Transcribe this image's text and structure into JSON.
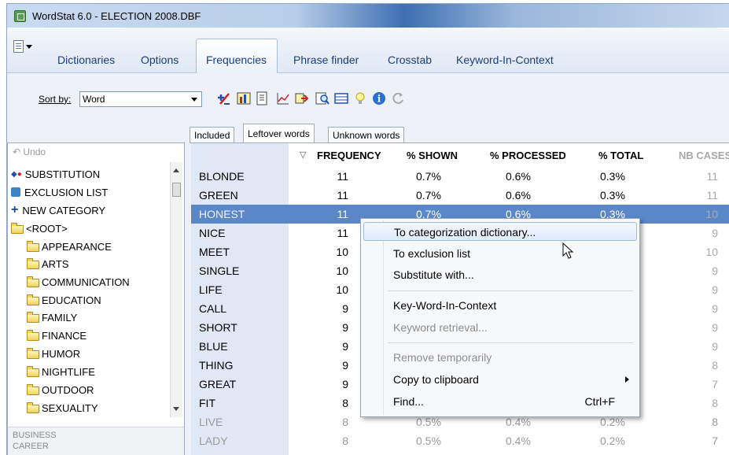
{
  "window": {
    "title": "WordStat 6.0 - ELECTION 2008.DBF"
  },
  "menu": {
    "items": [
      "Dictionaries",
      "Options",
      "Frequencies",
      "Phrase finder",
      "Crosstab",
      "Keyword-In-Context"
    ],
    "active": "Frequencies"
  },
  "toolbar": {
    "sort_label": "Sort by:",
    "sort_value": "Word",
    "icons": [
      "add-remove-icon",
      "chart-icon",
      "export-icon",
      "graph-icon",
      "arrow-icon",
      "search-icon",
      "table-icon",
      "bulb-icon",
      "info-icon",
      "refresh-icon"
    ]
  },
  "subtabs": [
    "Included",
    "Leftover words",
    "Unknown words"
  ],
  "left": {
    "undo": "Undo",
    "substitution": "SUBSTITUTION",
    "exclusion": "EXCLUSION LIST",
    "new_category": "NEW CATEGORY",
    "root": "<ROOT>",
    "categories": [
      "APPEARANCE",
      "ARTS",
      "COMMUNICATION",
      "EDUCATION",
      "FAMILY",
      "FINANCE",
      "HUMOR",
      "NIGHTLIFE",
      "OUTDOOR",
      "SEXUALITY"
    ],
    "bottom": [
      "BUSINESS",
      "CAREER"
    ]
  },
  "table": {
    "headers": [
      "FREQUENCY",
      "% SHOWN",
      "% PROCESSED",
      "% TOTAL",
      "NB CASES"
    ],
    "rows": [
      {
        "word": "BLONDE",
        "freq": "11",
        "shown": "0.7%",
        "proc": "0.6%",
        "total": "0.3%",
        "nb": "11"
      },
      {
        "word": "GREEN",
        "freq": "11",
        "shown": "0.7%",
        "proc": "0.6%",
        "total": "0.3%",
        "nb": "11"
      },
      {
        "word": "HONEST",
        "freq": "11",
        "shown": "0.7%",
        "proc": "0.6%",
        "total": "0.3%",
        "nb": "10"
      },
      {
        "word": "NICE",
        "freq": "11",
        "shown": "",
        "proc": "",
        "total": "",
        "nb": "9"
      },
      {
        "word": "MEET",
        "freq": "10",
        "shown": "",
        "proc": "",
        "total": "",
        "nb": "10"
      },
      {
        "word": "SINGLE",
        "freq": "10",
        "shown": "",
        "proc": "",
        "total": "",
        "nb": "9"
      },
      {
        "word": "LIFE",
        "freq": "10",
        "shown": "",
        "proc": "",
        "total": "",
        "nb": "9"
      },
      {
        "word": "CALL",
        "freq": "9",
        "shown": "",
        "proc": "",
        "total": "",
        "nb": "9"
      },
      {
        "word": "SHORT",
        "freq": "9",
        "shown": "",
        "proc": "",
        "total": "",
        "nb": "9"
      },
      {
        "word": "BLUE",
        "freq": "9",
        "shown": "",
        "proc": "",
        "total": "",
        "nb": "9"
      },
      {
        "word": "THING",
        "freq": "9",
        "shown": "",
        "proc": "",
        "total": "",
        "nb": "8"
      },
      {
        "word": "GREAT",
        "freq": "9",
        "shown": "",
        "proc": "",
        "total": "",
        "nb": "7"
      },
      {
        "word": "FIT",
        "freq": "8",
        "shown": "",
        "proc": "",
        "total": "",
        "nb": "8"
      },
      {
        "word": "LIVE",
        "freq": "8",
        "shown": "0.5%",
        "proc": "0.4%",
        "total": "0.2%",
        "nb": "8"
      },
      {
        "word": "LADY",
        "freq": "8",
        "shown": "0.5%",
        "proc": "0.4%",
        "total": "0.2%",
        "nb": "7"
      }
    ]
  },
  "context_menu": {
    "items": [
      {
        "label": "To categorization dictionary...",
        "state": "hover"
      },
      {
        "label": "To exclusion list",
        "state": "normal"
      },
      {
        "label": "Substitute with...",
        "state": "normal"
      },
      {
        "label": "Key-Word-In-Context",
        "state": "normal"
      },
      {
        "label": "Keyword retrieval...",
        "state": "disabled"
      },
      {
        "label": "Remove temporarily",
        "state": "disabled"
      },
      {
        "label": "Copy to clipboard",
        "state": "submenu"
      },
      {
        "label": "Find...",
        "state": "normal",
        "shortcut": "Ctrl+F"
      }
    ]
  },
  "colors": {
    "accent": "#5b86c8",
    "title_text": "#1a3e7a"
  }
}
